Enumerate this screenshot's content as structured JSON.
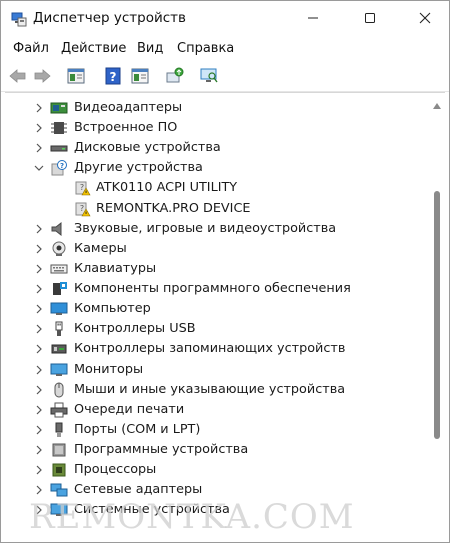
{
  "window": {
    "title": "Диспетчер устройств"
  },
  "menu": [
    "Файл",
    "Действие",
    "Вид",
    "Справка"
  ],
  "toolbar": [
    {
      "name": "back-arrow-icon"
    },
    {
      "name": "forward-arrow-icon"
    },
    {
      "name": "show-hide-console-tree-icon"
    },
    {
      "name": "help-icon"
    },
    {
      "name": "properties-icon"
    },
    {
      "name": "update-driver-icon"
    },
    {
      "name": "scan-hardware-icon"
    }
  ],
  "tree": [
    {
      "label": "Видеоадаптеры",
      "icon": "display-adapter-icon",
      "expanded": false,
      "level": 0
    },
    {
      "label": "Встроенное ПО",
      "icon": "firmware-chip-icon",
      "expanded": false,
      "level": 0
    },
    {
      "label": "Дисковые устройства",
      "icon": "disk-drive-icon",
      "expanded": false,
      "level": 0
    },
    {
      "label": "Другие устройства",
      "icon": "unknown-device-icon",
      "expanded": true,
      "level": 0
    },
    {
      "label": "ATK0110 ACPI UTILITY",
      "icon": "unknown-device-warning-icon",
      "level": 1
    },
    {
      "label": "REMONTKA.PRO DEVICE",
      "icon": "unknown-device-warning-icon",
      "level": 1
    },
    {
      "label": "Звуковые, игровые и видеоустройства",
      "icon": "speaker-icon",
      "expanded": false,
      "level": 0
    },
    {
      "label": "Камеры",
      "icon": "camera-icon",
      "expanded": false,
      "level": 0
    },
    {
      "label": "Клавиатуры",
      "icon": "keyboard-icon",
      "expanded": false,
      "level": 0
    },
    {
      "label": "Компоненты программного обеспечения",
      "icon": "software-component-icon",
      "expanded": false,
      "level": 0
    },
    {
      "label": "Компьютер",
      "icon": "computer-icon",
      "expanded": false,
      "level": 0
    },
    {
      "label": "Контроллеры USB",
      "icon": "usb-icon",
      "expanded": false,
      "level": 0
    },
    {
      "label": "Контроллеры запоминающих устройств",
      "icon": "storage-controller-icon",
      "expanded": false,
      "level": 0
    },
    {
      "label": "Мониторы",
      "icon": "monitor-icon",
      "expanded": false,
      "level": 0
    },
    {
      "label": "Мыши и иные указывающие устройства",
      "icon": "mouse-icon",
      "expanded": false,
      "level": 0
    },
    {
      "label": "Очереди печати",
      "icon": "printer-icon",
      "expanded": false,
      "level": 0
    },
    {
      "label": "Порты (COM и LPT)",
      "icon": "port-icon",
      "expanded": false,
      "level": 0
    },
    {
      "label": "Программные устройства",
      "icon": "software-device-icon",
      "expanded": false,
      "level": 0
    },
    {
      "label": "Процессоры",
      "icon": "processor-icon",
      "expanded": false,
      "level": 0
    },
    {
      "label": "Сетевые адаптеры",
      "icon": "network-adapter-icon",
      "expanded": false,
      "level": 0
    },
    {
      "label": "Системные устройства",
      "icon": "system-device-icon",
      "expanded": false,
      "level": 0
    }
  ],
  "watermark": "REMONTKA.COM",
  "colors": {
    "accent": "#1f8fd6",
    "chevron": "#555555",
    "scrollbar": "#8a8a8a"
  }
}
